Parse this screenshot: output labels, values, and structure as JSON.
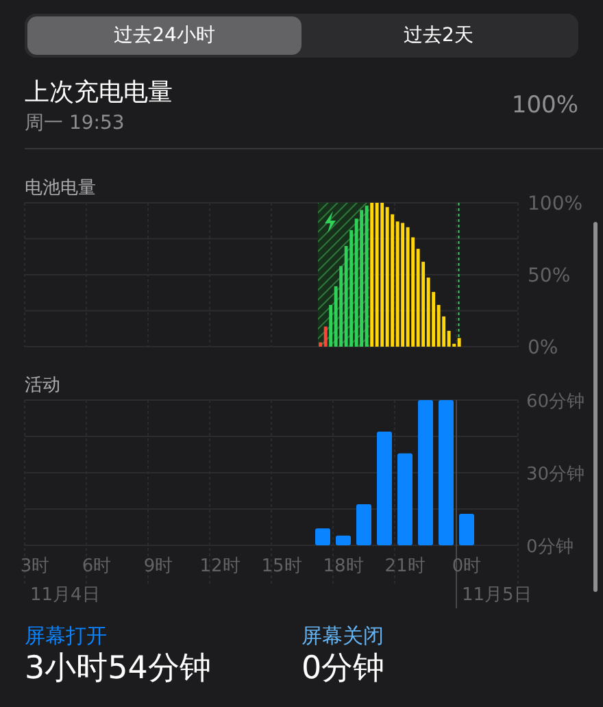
{
  "tabs": [
    {
      "label": "过去24小时",
      "selected": true
    },
    {
      "label": "过去2天",
      "selected": false
    }
  ],
  "last_charge": {
    "title": "上次充电电量",
    "time": "周一 19:53",
    "value": "100%"
  },
  "battery": {
    "title": "电池电量",
    "chart_data": {
      "type": "bar",
      "stacked": true,
      "grid": true,
      "ylim": [
        0,
        100
      ],
      "categories": [
        null,
        null,
        null,
        null,
        null,
        null,
        null,
        null,
        null,
        null,
        null,
        null,
        null,
        null,
        null,
        null,
        null,
        null,
        null,
        null,
        null,
        null,
        null,
        null,
        null,
        null,
        null,
        null
      ],
      "series": [
        {
          "color": "#ff453a",
          "values": [
            3,
            14,
            null,
            null,
            null,
            null,
            null,
            null,
            null,
            null,
            null,
            null,
            null,
            null,
            null,
            null,
            null,
            null,
            null,
            null,
            null,
            null,
            null,
            null,
            null,
            null,
            null,
            null
          ]
        },
        {
          "color": "#30d158",
          "values": [
            null,
            null,
            29,
            42,
            56,
            70,
            81,
            89,
            95,
            98,
            null,
            null,
            null,
            null,
            null,
            null,
            null,
            null,
            null,
            null,
            null,
            null,
            null,
            null,
            null,
            null,
            null,
            null
          ]
        },
        {
          "color": "#ffd60a",
          "values": [
            null,
            null,
            null,
            null,
            null,
            null,
            null,
            null,
            null,
            null,
            100,
            100,
            100,
            97,
            92,
            87,
            86,
            83,
            76,
            68,
            59,
            48,
            38,
            29,
            21,
            11,
            2,
            6
          ]
        }
      ],
      "yticks": [
        {
          "value": 0,
          "label": "0%"
        },
        {
          "value": 50,
          "label": "50%"
        },
        {
          "value": 100,
          "label": "100%"
        }
      ]
    }
  },
  "activity": {
    "title": "活动",
    "chart_data": {
      "type": "bar",
      "grid": true,
      "ylim": [
        0,
        60
      ],
      "categories": [
        "3时",
        null,
        null,
        "6时",
        null,
        null,
        "9时",
        null,
        null,
        "12时",
        null,
        null,
        "15时",
        null,
        null,
        "18时",
        null,
        null,
        "21时",
        null,
        null,
        "0时",
        null,
        null
      ],
      "series": [
        {
          "color": "#0a84ff",
          "values": [
            0,
            0,
            0,
            0,
            0,
            0,
            0,
            0,
            0,
            0,
            0,
            0,
            0,
            0,
            7,
            4,
            17,
            47,
            38,
            60,
            60,
            13,
            0,
            0
          ]
        }
      ],
      "yticks": [
        {
          "value": 0,
          "label": "0分钟"
        },
        {
          "value": 30,
          "label": "30分钟"
        },
        {
          "value": 60,
          "label": "60分钟"
        }
      ]
    },
    "dates": [
      "11月4日",
      "11月5日"
    ]
  },
  "stats": [
    {
      "label": "屏幕打开",
      "value": "3小时54分钟",
      "color": "#0a84ff"
    },
    {
      "label": "屏幕关闭",
      "value": "0分钟",
      "color": "#64b5f6"
    }
  ]
}
